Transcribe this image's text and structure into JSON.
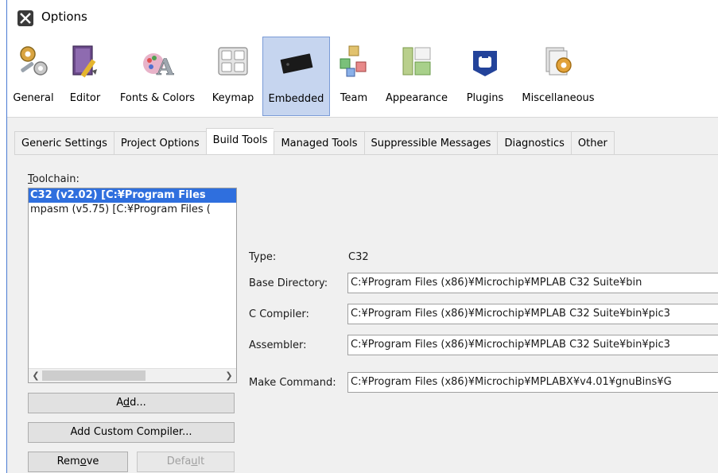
{
  "window": {
    "title": "Options",
    "accent": "#2f6fde"
  },
  "categories": [
    {
      "label": "General",
      "icon": "gears-wrench-icon",
      "selected": false
    },
    {
      "label": "Editor",
      "icon": "book-pen-icon",
      "selected": false
    },
    {
      "label": "Fonts & Colors",
      "icon": "palette-font-icon",
      "selected": false
    },
    {
      "label": "Keymap",
      "icon": "keyboard-icon",
      "selected": false
    },
    {
      "label": "Embedded",
      "icon": "chip-icon",
      "selected": true
    },
    {
      "label": "Team",
      "icon": "team-cubes-icon",
      "selected": false
    },
    {
      "label": "Appearance",
      "icon": "appearance-layout-icon",
      "selected": false
    },
    {
      "label": "Plugins",
      "icon": "plugin-puzzle-icon",
      "selected": false
    },
    {
      "label": "Miscellaneous",
      "icon": "misc-gears-icon",
      "selected": false
    }
  ],
  "tabs": [
    {
      "label": "Generic Settings",
      "selected": false
    },
    {
      "label": "Project Options",
      "selected": false
    },
    {
      "label": "Build Tools",
      "selected": true
    },
    {
      "label": "Managed Tools",
      "selected": false
    },
    {
      "label": "Suppressible Messages",
      "selected": false
    },
    {
      "label": "Diagnostics",
      "selected": false
    },
    {
      "label": "Other",
      "selected": false
    }
  ],
  "toolchain": {
    "label_mnemonic": "T",
    "label_rest": "oolchain:",
    "items": [
      {
        "text": "C32 (v2.02) [C:¥Program Files",
        "selected": true
      },
      {
        "text": "mpasm (v5.75) [C:¥Program Files (",
        "selected": false
      }
    ]
  },
  "buttons": {
    "add_a": "A",
    "add_m": "d",
    "add_b": "d...",
    "add_custom": "Add Custom Compiler...",
    "remove_a": "Rem",
    "remove_m": "o",
    "remove_b": "ve",
    "default_a": "Defa",
    "default_m": "u",
    "default_b": "lt"
  },
  "form": {
    "type_label": "Type:",
    "type_value": "C32",
    "base_dir_label": "Base Directory:",
    "base_dir_value": "C:¥Program Files (x86)¥Microchip¥MPLAB C32 Suite¥bin",
    "c_compiler_label": "C Compiler:",
    "c_compiler_value": "C:¥Program Files (x86)¥Microchip¥MPLAB C32 Suite¥bin¥pic3",
    "assembler_label": "Assembler:",
    "assembler_value": "C:¥Program Files (x86)¥Microchip¥MPLAB C32 Suite¥bin¥pic3",
    "make_label": "Make Command:",
    "make_value": "C:¥Program Files (x86)¥Microchip¥MPLABX¥v4.01¥gnuBins¥G"
  }
}
